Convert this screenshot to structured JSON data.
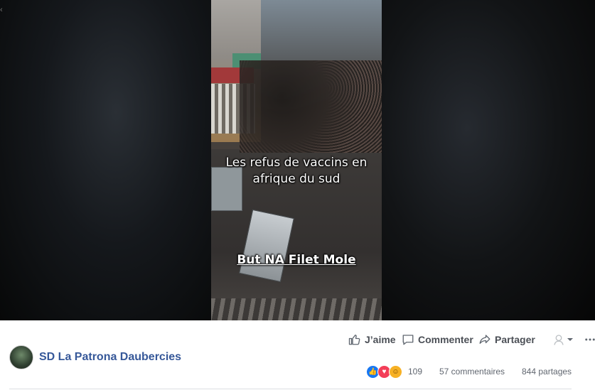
{
  "video": {
    "caption_line1": "Les refus de vaccins en",
    "caption_line2": "afrique du sud",
    "caption_bottom": "But NA Filet Mole"
  },
  "post": {
    "author": "SD La Patrona Daubercies",
    "actions": {
      "like": "J’aime",
      "comment": "Commenter",
      "share": "Partager"
    },
    "stats": {
      "reactions_count": "109",
      "comments": "57 commentaires",
      "shares": "844 partages"
    },
    "reaction_icons": [
      "like-icon",
      "love-icon",
      "haha-icon"
    ]
  },
  "colors": {
    "link": "#365899",
    "like": "#1877f2",
    "love": "#f33e58",
    "haha": "#f7b125"
  }
}
